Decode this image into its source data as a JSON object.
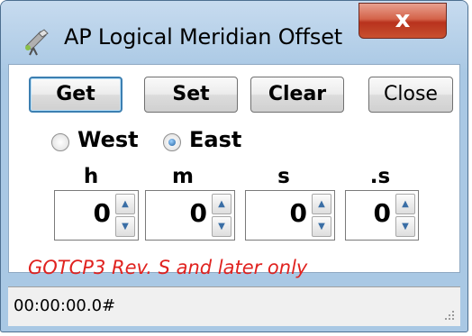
{
  "window": {
    "title": "AP Logical Meridian Offset",
    "close_glyph": "x",
    "icon": "telescope-icon"
  },
  "toolbar": {
    "get_label": "Get",
    "set_label": "Set",
    "clear_label": "Clear",
    "close_label": "Close"
  },
  "direction": {
    "west_label": "West",
    "east_label": "East",
    "selected": "East"
  },
  "fields": [
    {
      "label": "h",
      "value": "0"
    },
    {
      "label": "m",
      "value": "0"
    },
    {
      "label": "s",
      "value": "0"
    },
    {
      "label": ".s",
      "value": "0"
    }
  ],
  "note": "GOTCP3 Rev. S and later only",
  "status": {
    "text": "00:00:00.0#"
  },
  "colors": {
    "note": "#e0221f",
    "titlebar": "#a9c8e4",
    "close_button": "#c8502f"
  }
}
